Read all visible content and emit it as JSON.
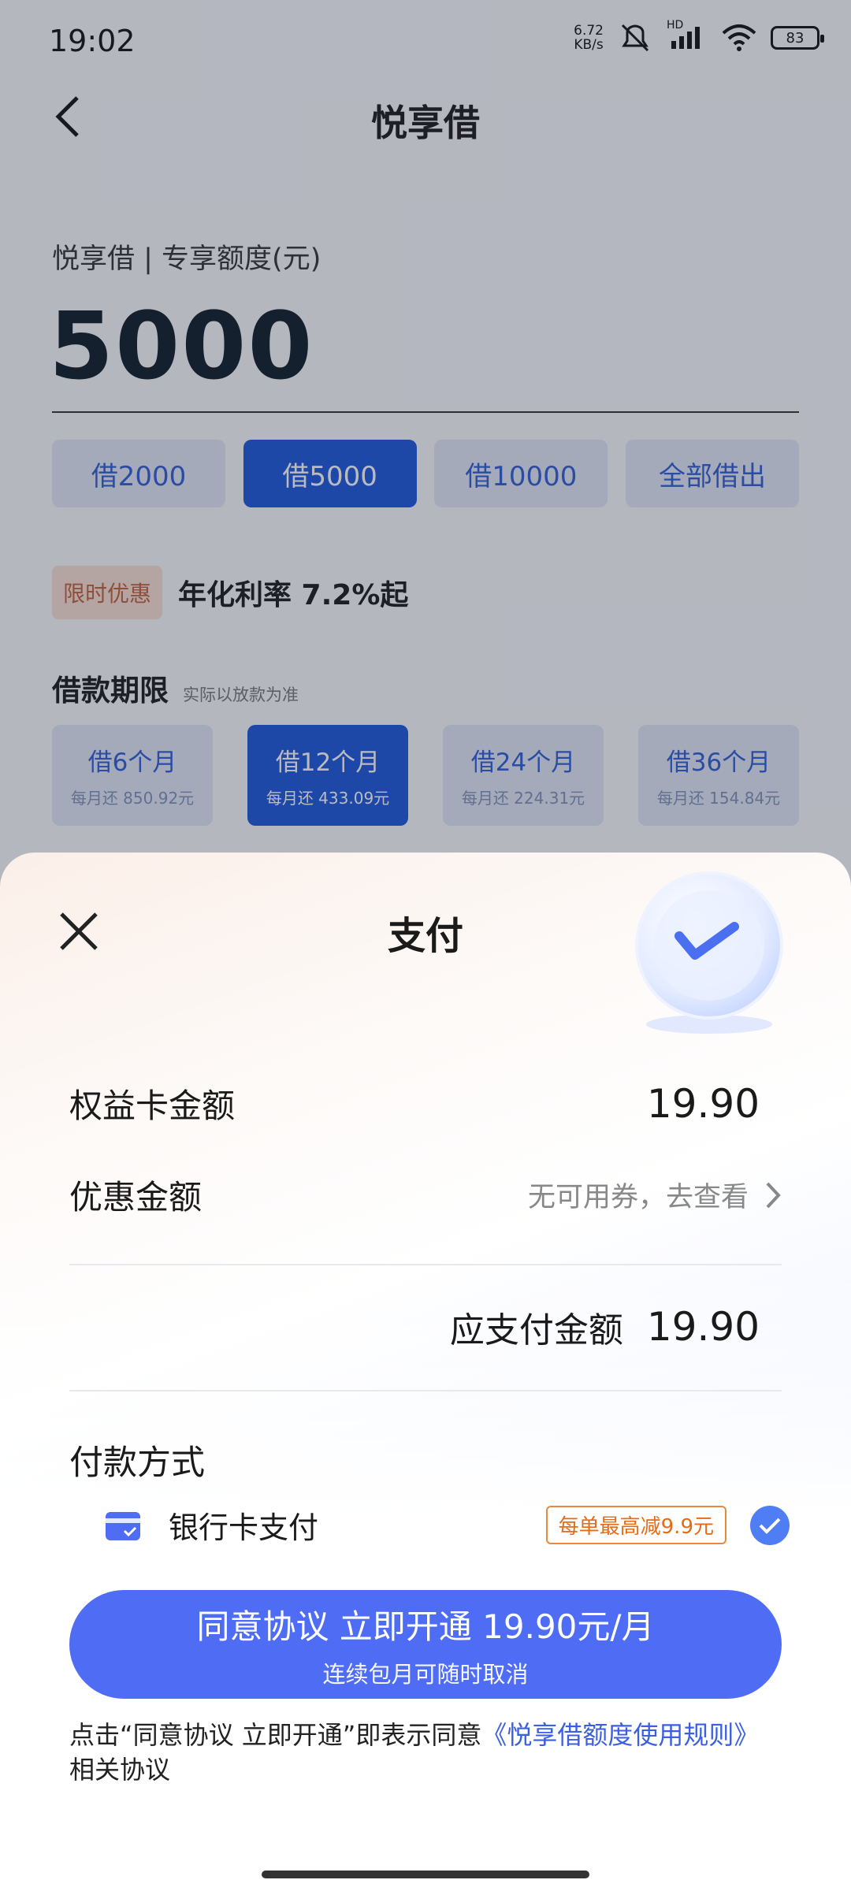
{
  "status_bar": {
    "time": "19:02",
    "net_speed_value": "6.72",
    "net_speed_unit": "KB/s",
    "battery": "83",
    "hd_label": "HD",
    "icons": [
      "mute-icon",
      "signal-icon",
      "wifi-icon",
      "battery-icon"
    ]
  },
  "header": {
    "title": "悦享借"
  },
  "loan": {
    "quota_label": "悦享借 | 专享额度(元)",
    "amount": "5000",
    "amount_buttons": [
      {
        "label": "借2000",
        "active": false
      },
      {
        "label": "借5000",
        "active": true
      },
      {
        "label": "借10000",
        "active": false
      },
      {
        "label": "全部借出",
        "active": false
      }
    ],
    "promo_tag": "限时优惠",
    "promo_rate": "年化利率 7.2%起",
    "term_title": "借款期限",
    "term_note": "实际以放款为准",
    "terms": [
      {
        "label": "借6个月",
        "monthly": "每月还 850.92元",
        "active": false
      },
      {
        "label": "借12个月",
        "monthly": "每月还 433.09元",
        "active": true
      },
      {
        "label": "借24个月",
        "monthly": "每月还 224.31元",
        "active": false
      },
      {
        "label": "借36个月",
        "monthly": "每月还 154.84元",
        "active": false
      }
    ]
  },
  "payment_sheet": {
    "title": "支付",
    "card_amount_label": "权益卡金额",
    "card_amount_value": "19.90",
    "discount_label": "优惠金额",
    "discount_value": "无可用券，去查看",
    "payable_label": "应支付金额",
    "payable_value": "19.90",
    "method_title": "付款方式",
    "method_name": "银行卡支付",
    "method_tag": "每单最高减9.9元",
    "cta_main": "同意协议 立即开通 19.90元/月",
    "cta_sub": "连续包月可随时取消",
    "agree_text": "点击“同意协议 立即开通”即表示同意",
    "agree_link": "《悦享借额度使用规则》",
    "agree_suffix": "相关协议"
  },
  "colors": {
    "primary_blue": "#1a56db",
    "cta_blue": "#4f6cf5",
    "promo_orange": "#e56b18"
  }
}
